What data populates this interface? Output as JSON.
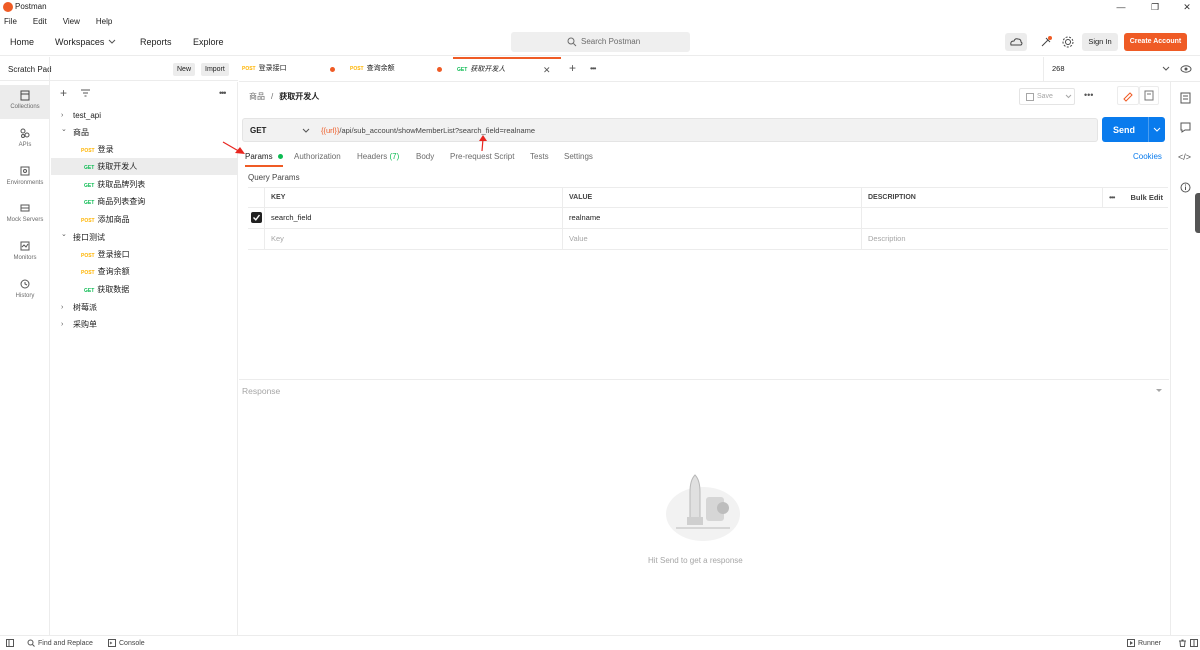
{
  "window": {
    "title": "Postman",
    "controls": {
      "minimize": "—",
      "maximize": "❐",
      "close": "✕"
    }
  },
  "menu": [
    "File",
    "Edit",
    "View",
    "Help"
  ],
  "header": {
    "nav": [
      "Home",
      "Workspaces",
      "Reports",
      "Explore"
    ],
    "search_placeholder": "Search Postman",
    "sign_in": "Sign In",
    "create_account": "Create Account"
  },
  "rail": [
    {
      "label": "Collections",
      "icon": "collections-icon"
    },
    {
      "label": "APIs",
      "icon": "apis-icon"
    },
    {
      "label": "Environments",
      "icon": "environments-icon"
    },
    {
      "label": "Mock Servers",
      "icon": "mock-servers-icon"
    },
    {
      "label": "Monitors",
      "icon": "monitors-icon"
    },
    {
      "label": "History",
      "icon": "history-icon"
    }
  ],
  "scratch": {
    "title": "Scratch Pad",
    "new": "New",
    "import": "Import"
  },
  "tree": [
    {
      "label": "test_api",
      "caret": "›"
    },
    {
      "label": "商品",
      "caret": "⌄"
    },
    {
      "method": "POST",
      "label": "登录"
    },
    {
      "method": "GET",
      "label": "获取开发人"
    },
    {
      "method": "GET",
      "label": "获取品牌列表"
    },
    {
      "method": "GET",
      "label": "商品列表查询"
    },
    {
      "method": "POST",
      "label": "添加商品"
    },
    {
      "label": "接口测试",
      "caret": "⌄"
    },
    {
      "method": "POST",
      "label": "登录接口"
    },
    {
      "method": "POST",
      "label": "查询余额"
    },
    {
      "method": "GET",
      "label": "获取数据"
    },
    {
      "label": "树莓派",
      "caret": "›"
    },
    {
      "label": "采购单",
      "caret": "›"
    }
  ],
  "tabs": [
    {
      "method": "POST",
      "label": "登录接口"
    },
    {
      "method": "POST",
      "label": "查询余额"
    },
    {
      "method": "GET",
      "label": "获取开发人"
    }
  ],
  "env": "268",
  "breadcrumb": {
    "parent": "商品",
    "sep": "/",
    "current": "获取开发人"
  },
  "save": "Save",
  "request": {
    "method": "GET",
    "url_var": "{{url}}",
    "url_rest": "/api/sub_account/showMemberList?search_field=realname",
    "send": "Send"
  },
  "subtabs": [
    "Params",
    "Authorization",
    "Headers",
    "Body",
    "Pre-request Script",
    "Tests",
    "Settings"
  ],
  "headers_count": "(7)",
  "cookies": "Cookies",
  "query_params_label": "Query Params",
  "params_table": {
    "headers": [
      "KEY",
      "VALUE",
      "DESCRIPTION"
    ],
    "bulk_edit": "Bulk Edit",
    "rows": [
      {
        "key": "search_field",
        "value": "realname",
        "description": ""
      }
    ],
    "placeholders": {
      "key": "Key",
      "value": "Value",
      "description": "Description"
    }
  },
  "response": {
    "label": "Response",
    "hint": "Hit Send to get a response"
  },
  "status": {
    "find_replace": "Find and Replace",
    "console": "Console",
    "runner": "Runner"
  },
  "colors": {
    "accent": "#ef5b25",
    "send": "#097bed",
    "get": "#0cbb52",
    "post": "#ffb400",
    "annotation": "#e8251f"
  }
}
